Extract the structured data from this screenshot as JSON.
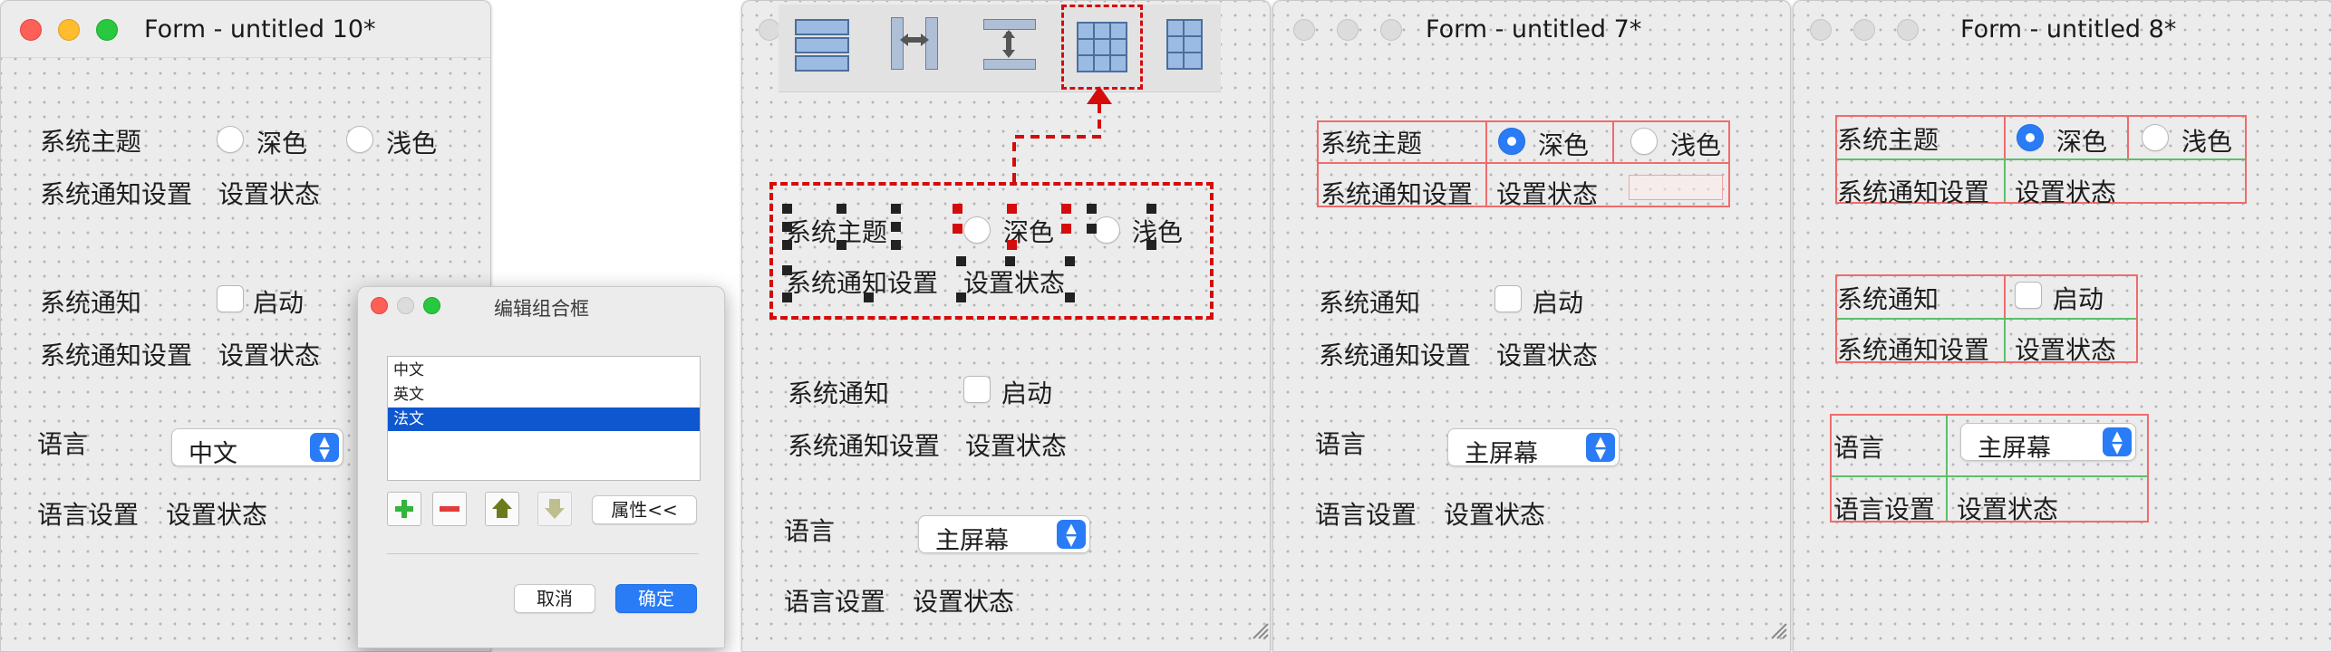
{
  "win1": {
    "title": "Form - untitled 10*",
    "theme_label": "系统主题",
    "dark": "深色",
    "light": "浅色",
    "notify_setting_label": "系统通知设置",
    "set_status": "设置状态",
    "notify_label": "系统通知",
    "enable": "启动",
    "notify_setting_label2": "系统通知设置",
    "set_status2": "设置状态",
    "lang_label": "语言",
    "lang_value": "中文",
    "lang_setting_label": "语言设置",
    "set_status3": "设置状态"
  },
  "dialog": {
    "title": "编辑组合框",
    "items": [
      "中文",
      "英文",
      "法文"
    ],
    "selected_index": 2,
    "props_button": "属性<<",
    "cancel": "取消",
    "ok": "确定"
  },
  "win2": {
    "toolbar_icons": [
      "layout-vertical-icon",
      "layout-horizontal-splitter-icon",
      "layout-vertical-splitter-icon",
      "layout-grid-icon",
      "layout-form-icon"
    ],
    "theme_label": "系统主题",
    "dark": "深色",
    "light": "浅色",
    "notify_setting_label": "系统通知设置",
    "set_status": "设置状态",
    "notify_label": "系统通知",
    "enable": "启动",
    "notify_setting_label2": "系统通知设置",
    "set_status2": "设置状态",
    "lang_label": "语言",
    "lang_value": "主屏幕",
    "lang_setting_label": "语言设置",
    "set_status3": "设置状态"
  },
  "win3": {
    "title": "Form - untitled 7*",
    "theme_label": "系统主题",
    "dark": "深色",
    "light": "浅色",
    "notify_setting_label": "系统通知设置",
    "set_status": "设置状态",
    "notify_label": "系统通知",
    "enable": "启动",
    "notify_setting_label2": "系统通知设置",
    "set_status2": "设置状态",
    "lang_label": "语言",
    "lang_value": "主屏幕",
    "lang_setting_label": "语言设置",
    "set_status3": "设置状态"
  },
  "win4": {
    "title": "Form - untitled 8*",
    "theme_label": "系统主题",
    "dark": "深色",
    "light": "浅色",
    "notify_setting_label": "系统通知设置",
    "set_status": "设置状态",
    "notify_label": "系统通知",
    "enable": "启动",
    "notify_setting_label2": "系统通知设置",
    "set_status2": "设置状态",
    "lang_label": "语言",
    "lang_value": "主屏幕",
    "lang_setting_label": "语言设置",
    "set_status3": "设置状态"
  },
  "colors": {
    "accent": "#2a7bf6",
    "layout_border": "#f06b6b",
    "grid_line": "#5bbf6b",
    "selection": "#d40c0c",
    "list_selection": "#0f57cf"
  }
}
